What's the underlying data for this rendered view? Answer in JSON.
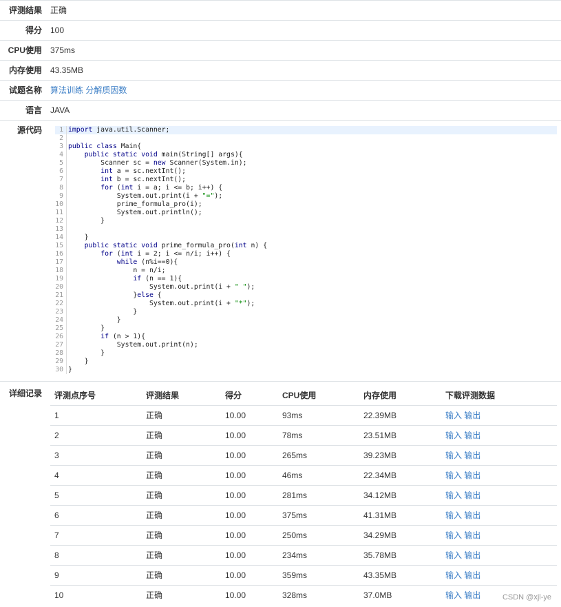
{
  "summary": {
    "result_label": "评测结果",
    "result_value": "正确",
    "score_label": "得分",
    "score_value": "100",
    "cpu_label": "CPU使用",
    "cpu_value": "375ms",
    "mem_label": "内存使用",
    "mem_value": "43.35MB",
    "problem_label": "试题名称",
    "problem_value": "算法训练 分解质因数",
    "lang_label": "语言",
    "lang_value": "JAVA"
  },
  "code": {
    "label": "源代码",
    "lines": [
      "import java.util.Scanner;",
      "",
      "public class Main{",
      "    public static void main(String[] args){",
      "        Scanner sc = new Scanner(System.in);",
      "        int a = sc.nextInt();",
      "        int b = sc.nextInt();",
      "        for (int i = a; i <= b; i++) {",
      "            System.out.print(i + \"=\");",
      "            prime_formula_pro(i);",
      "            System.out.println();",
      "        }",
      "",
      "    }",
      "    public static void prime_formula_pro(int n) {",
      "        for (int i = 2; i <= n/i; i++) {",
      "            while (n%i==0){",
      "                n = n/i;",
      "                if (n == 1){",
      "                    System.out.print(i + \" \");",
      "                }else {",
      "                    System.out.print(i + \"*\");",
      "                }",
      "            }",
      "        }",
      "        if (n > 1){",
      "            System.out.print(n);",
      "        }",
      "    }",
      "}"
    ]
  },
  "details": {
    "label": "详细记录",
    "headers": [
      "评测点序号",
      "评测结果",
      "得分",
      "CPU使用",
      "内存使用",
      "下载评测数据"
    ],
    "input_link": "输入",
    "output_link": "输出",
    "rows": [
      [
        "1",
        "正确",
        "10.00",
        "93ms",
        "22.39MB"
      ],
      [
        "2",
        "正确",
        "10.00",
        "78ms",
        "23.51MB"
      ],
      [
        "3",
        "正确",
        "10.00",
        "265ms",
        "39.23MB"
      ],
      [
        "4",
        "正确",
        "10.00",
        "46ms",
        "22.34MB"
      ],
      [
        "5",
        "正确",
        "10.00",
        "281ms",
        "34.12MB"
      ],
      [
        "6",
        "正确",
        "10.00",
        "375ms",
        "41.31MB"
      ],
      [
        "7",
        "正确",
        "10.00",
        "250ms",
        "34.29MB"
      ],
      [
        "8",
        "正确",
        "10.00",
        "234ms",
        "35.78MB"
      ],
      [
        "9",
        "正确",
        "10.00",
        "359ms",
        "43.35MB"
      ],
      [
        "10",
        "正确",
        "10.00",
        "328ms",
        "37.0MB"
      ]
    ]
  },
  "watermark": "CSDN @xjl-ye",
  "colors": {
    "link": "#3b7ec6",
    "border": "#dee2e6",
    "highlight": "#e8f2fe"
  }
}
